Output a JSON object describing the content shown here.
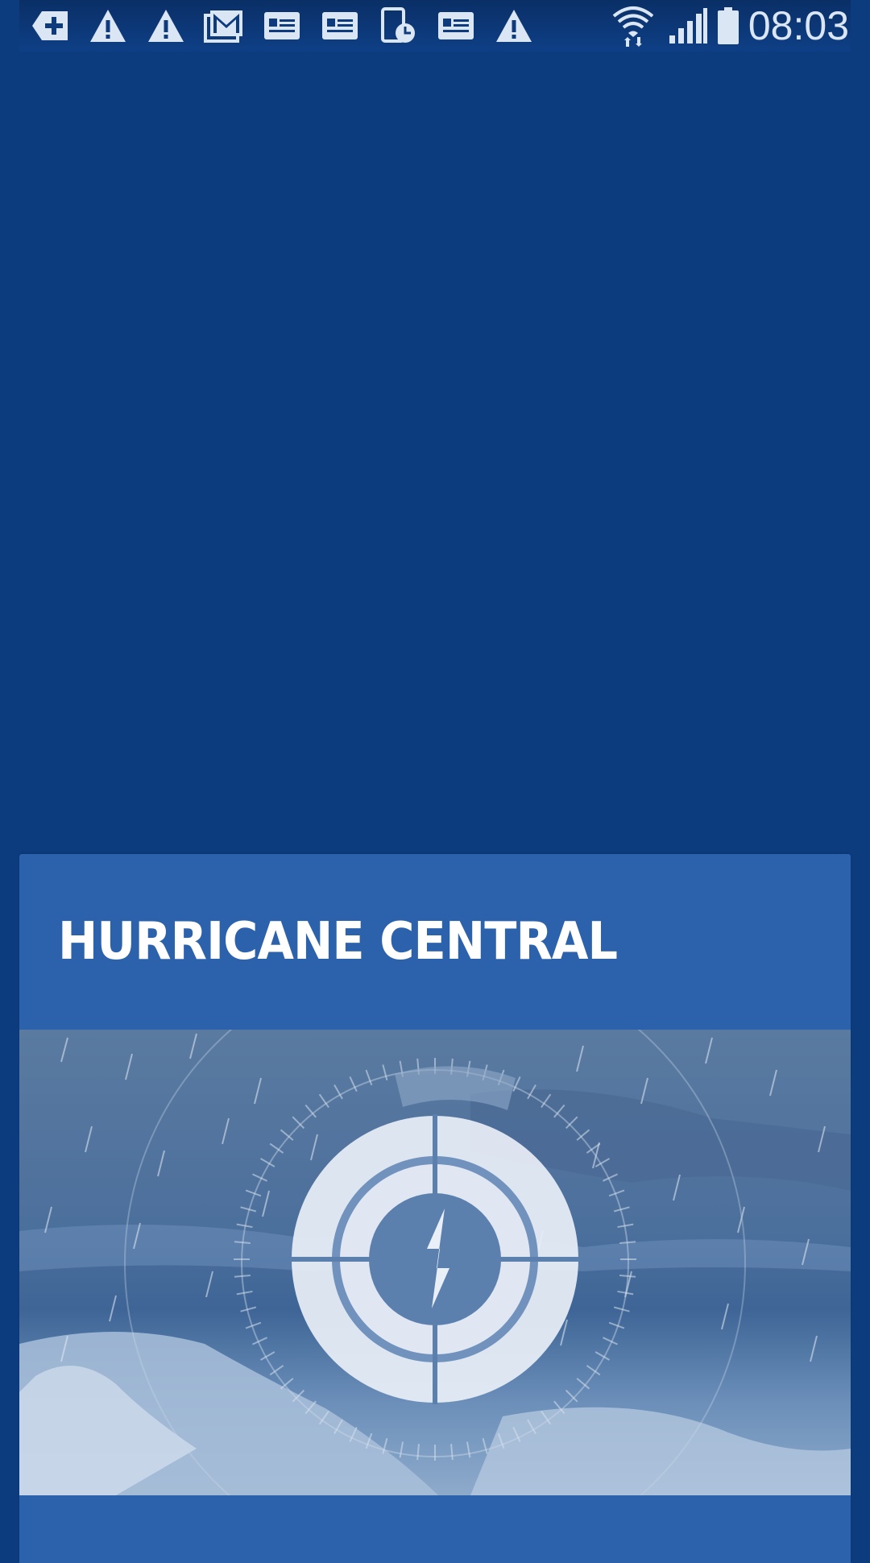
{
  "status_bar": {
    "time": "08:03",
    "notification_icons": [
      "add-notification-icon",
      "warning-icon",
      "warning-icon",
      "gmail-icon",
      "news-icon",
      "news-icon",
      "device-schedule-icon",
      "news-icon",
      "warning-icon"
    ],
    "system_icons": [
      "wifi-icon",
      "cell-signal-icon",
      "battery-icon"
    ]
  },
  "card": {
    "title": "HURRICANE CENTRAL",
    "image_description_icon": "hurricane-radar-icon"
  },
  "colors": {
    "background": "#0c3c7e",
    "card": "#2b62ab",
    "status_bar": "#0e3f86",
    "icon": "#dbe6f4"
  }
}
